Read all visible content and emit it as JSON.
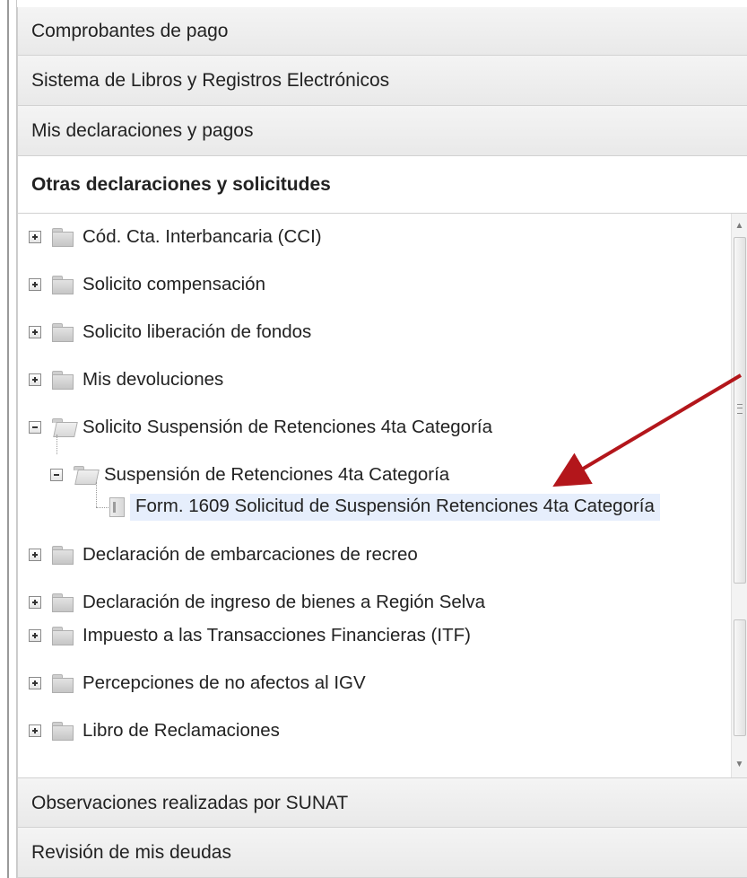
{
  "accordion": {
    "sections": [
      {
        "label": "Comprobantes de pago"
      },
      {
        "label": "Sistema de Libros y Registros Electrónicos"
      },
      {
        "label": "Mis declaraciones y pagos"
      },
      {
        "label": "Otras declaraciones y solicitudes"
      }
    ],
    "bottom_sections": [
      {
        "label": "Observaciones realizadas por SUNAT"
      },
      {
        "label": "Revisión de mis deudas"
      }
    ]
  },
  "tree": {
    "items": [
      {
        "label": "Cód. Cta. Interbancaria (CCI)",
        "expanded": false
      },
      {
        "label": "Solicito compensación",
        "expanded": false
      },
      {
        "label": "Solicito liberación de fondos",
        "expanded": false
      },
      {
        "label": "Mis devoluciones",
        "expanded": false
      },
      {
        "label": "Solicito Suspensión de Retenciones 4ta Categoría",
        "expanded": true
      },
      {
        "label": "Suspensión de Retenciones 4ta Categoría",
        "expanded": true
      },
      {
        "label": "Form. 1609 Solicitud de Suspensión Retenciones 4ta Categoría",
        "selected": true
      },
      {
        "label": "Declaración de embarcaciones de recreo",
        "expanded": false
      },
      {
        "label": "Declaración de ingreso de bienes a Región Selva",
        "expanded": false
      },
      {
        "label": "Impuesto a las Transacciones Financieras (ITF)",
        "expanded": false
      },
      {
        "label": "Percepciones de no afectos al IGV",
        "expanded": false
      },
      {
        "label": "Libro de Reclamaciones",
        "expanded": false
      }
    ]
  },
  "colors": {
    "selection": "#e6eefc",
    "annotation_arrow": "#b3161b"
  }
}
